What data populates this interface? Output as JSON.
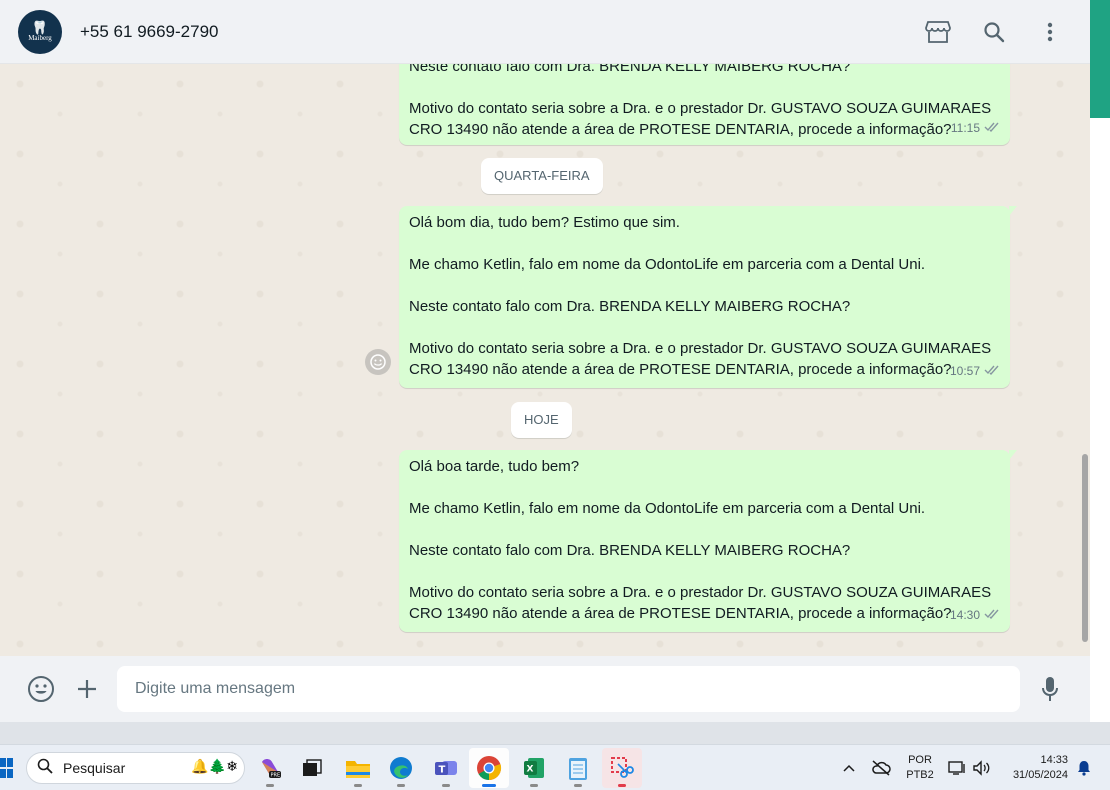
{
  "header": {
    "avatar_brand": "Maiberg",
    "contact_name": "+55 61 9669-2790",
    "icons": [
      "store-icon",
      "search-icon",
      "more-vertical-icon"
    ]
  },
  "chat": {
    "partial_message": {
      "line_top": "Neste contato falo com Dra. BRENDA KELLY MAIBERG ROCHA?",
      "paragraph": "Motivo do contato seria sobre a Dra. e o prestador Dr. GUSTAVO SOUZA GUIMARAES\nCRO 13490 não atende a área de PROTESE DENTARIA, procede a informação?",
      "time": "11:15"
    },
    "day_chip_1": "QUARTA-FEIRA",
    "message_2": {
      "p1": "Olá bom dia, tudo bem? Estimo que sim.",
      "p2": "Me chamo Ketlin, falo em nome da OdontoLife em parceria com a Dental Uni.",
      "p3": "Neste contato falo com Dra. BRENDA KELLY MAIBERG ROCHA?",
      "p4": "Motivo do contato seria sobre a Dra. e o prestador Dr. GUSTAVO SOUZA GUIMARAES\nCRO 13490 não atende a área de PROTESE DENTARIA, procede a informação?",
      "time": "10:57"
    },
    "day_chip_2": "HOJE",
    "message_3": {
      "p1": "Olá boa tarde, tudo bem?",
      "p2": "Me chamo Ketlin, falo em nome da OdontoLife em parceria com a Dental Uni.",
      "p3": "Neste contato falo com Dra. BRENDA KELLY MAIBERG ROCHA?",
      "p4": "Motivo do contato seria sobre a Dra. e o prestador Dr. GUSTAVO SOUZA GUIMARAES\nCRO 13490 não atende a área de PROTESE DENTARIA, procede a informação?",
      "time": "14:30"
    },
    "read_receipt": "double-check-icon"
  },
  "composer": {
    "placeholder": "Digite uma mensagem"
  },
  "taskbar": {
    "search_label": "Pesquisar",
    "apps": [
      "copilot-icon",
      "task-view-icon",
      "file-explorer-icon",
      "edge-icon",
      "teams-icon",
      "chrome-icon",
      "excel-icon",
      "notepad-icon",
      "snipping-tool-icon"
    ],
    "active_app": "chrome-icon",
    "language_top": "POR",
    "language_bottom": "PTB2",
    "time": "14:33",
    "date": "31/05/2024"
  },
  "colors": {
    "outgoing_bubble": "#d9fdd3",
    "chat_bg": "#efeae2",
    "accent": "#1fa383",
    "read_tick": "#53bdeb"
  }
}
